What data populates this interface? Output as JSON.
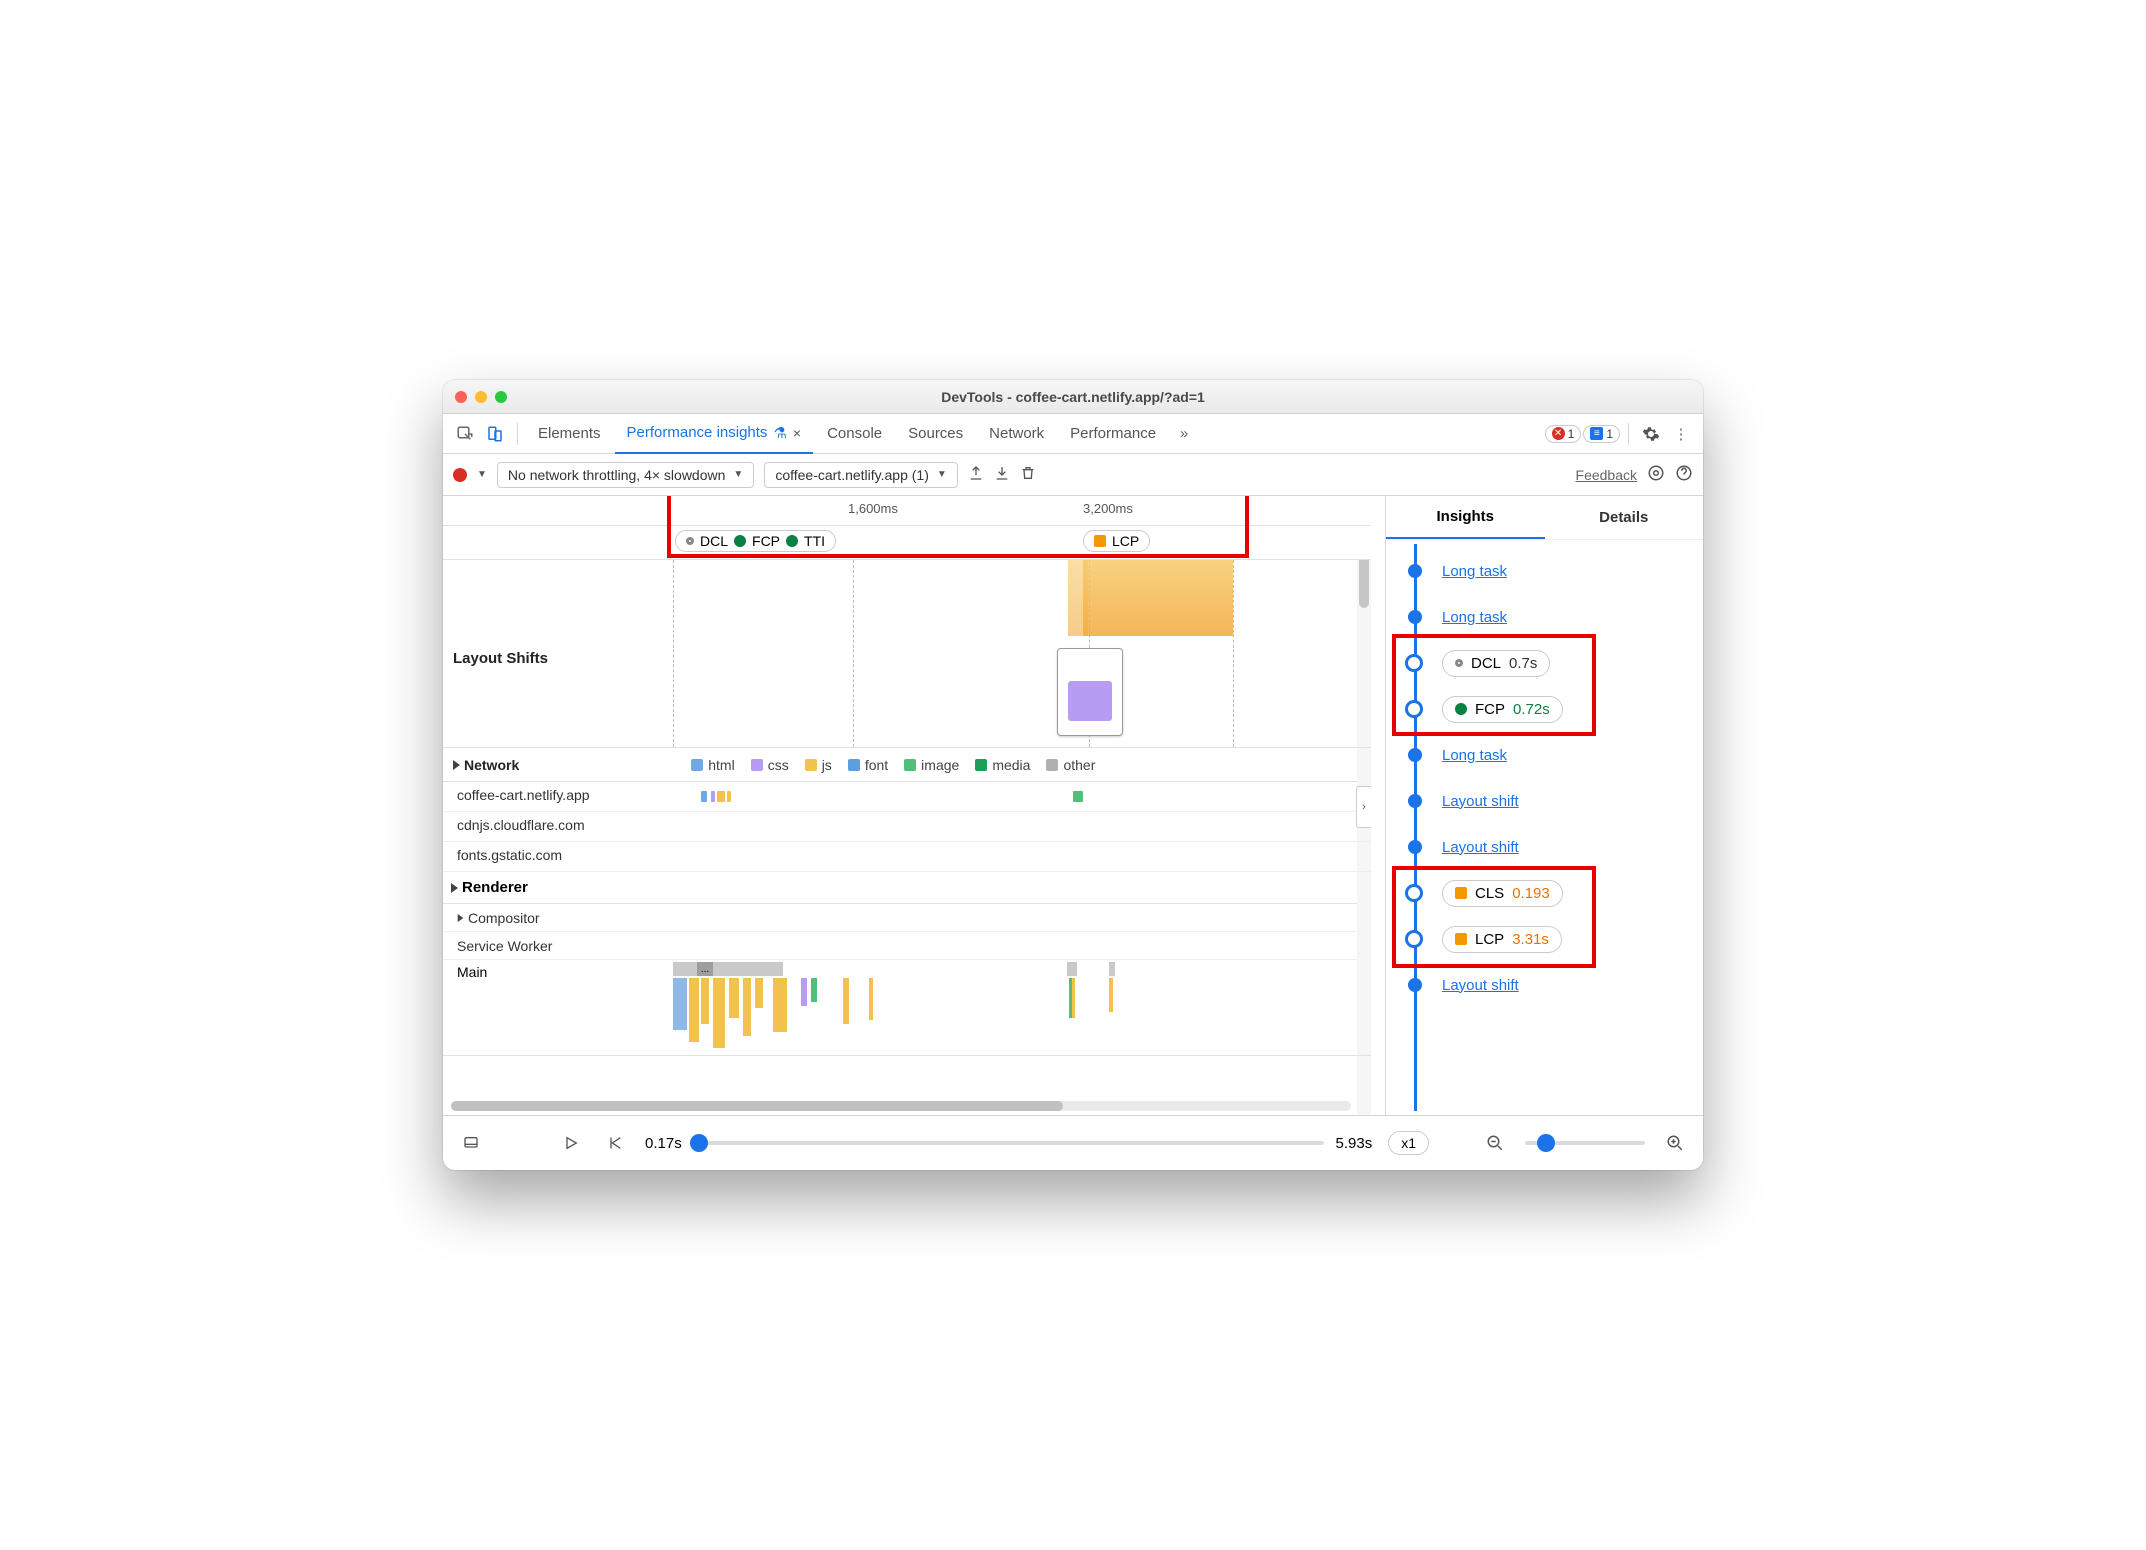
{
  "window": {
    "title": "DevTools - coffee-cart.netlify.app/?ad=1"
  },
  "tabs": {
    "items": [
      "Elements",
      "Performance insights",
      "Console",
      "Sources",
      "Network",
      "Performance"
    ],
    "active_index": 1,
    "errors_count": "1",
    "messages_count": "1"
  },
  "toolbar": {
    "throttle": "No network throttling, 4× slowdown",
    "target": "coffee-cart.netlify.app (1)",
    "feedback": "Feedback"
  },
  "time_ruler": {
    "t1": "1,600ms",
    "t2": "3,200ms"
  },
  "markers": {
    "group1": [
      {
        "kind": "ring",
        "label": "DCL"
      },
      {
        "kind": "green",
        "label": "FCP"
      },
      {
        "kind": "green",
        "label": "TTI"
      }
    ],
    "group2": [
      {
        "kind": "sq-orange",
        "label": "LCP"
      }
    ]
  },
  "lanes": {
    "shifts": "Layout Shifts",
    "network": "Network",
    "renderer": "Renderer",
    "compositor": "Compositor",
    "service_worker": "Service Worker",
    "main": "Main"
  },
  "legend": {
    "html": "html",
    "css": "css",
    "js": "js",
    "font": "font",
    "image": "image",
    "media": "media",
    "other": "other"
  },
  "network_rows": [
    "coffee-cart.netlify.app",
    "cdnjs.cloudflare.com",
    "fonts.gstatic.com"
  ],
  "main_more": "...",
  "footer": {
    "start": "0.17s",
    "end": "5.93s",
    "speed": "x1"
  },
  "insights": {
    "tabs": {
      "insights": "Insights",
      "details": "Details"
    },
    "items": [
      {
        "type": "link",
        "label": "Long task"
      },
      {
        "type": "link",
        "label": "Long task"
      },
      {
        "type": "pill",
        "icon": "ring",
        "label": "DCL",
        "value": "0.7s",
        "valclass": ""
      },
      {
        "type": "pill",
        "icon": "green",
        "label": "FCP",
        "value": "0.72s",
        "valclass": "green"
      },
      {
        "type": "link",
        "label": "Long task"
      },
      {
        "type": "link",
        "label": "Layout shift"
      },
      {
        "type": "link",
        "label": "Layout shift"
      },
      {
        "type": "pill",
        "icon": "sq-orange",
        "label": "CLS",
        "value": "0.193",
        "valclass": "orange"
      },
      {
        "type": "pill",
        "icon": "sq-orange",
        "label": "LCP",
        "value": "3.31s",
        "valclass": "orange"
      },
      {
        "type": "link",
        "label": "Layout shift"
      }
    ]
  }
}
